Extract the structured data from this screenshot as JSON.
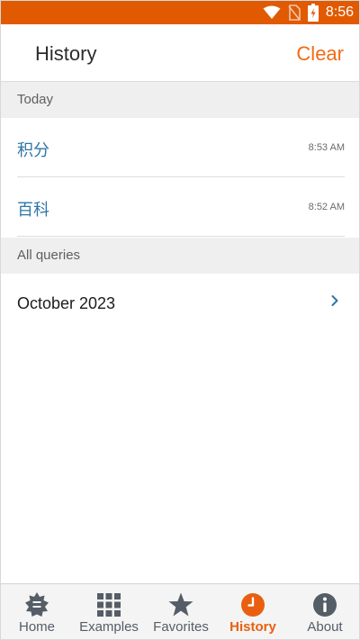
{
  "status_bar": {
    "time": "8:56",
    "background": "#e15a02",
    "icons": [
      "wifi-icon",
      "no-sim-icon",
      "battery-charging-icon"
    ]
  },
  "header": {
    "title": "History",
    "clear_label": "Clear",
    "accent_color": "#f26b15"
  },
  "today": {
    "heading": "Today",
    "items": [
      {
        "query": "积分",
        "time": "8:53 AM"
      },
      {
        "query": "百科",
        "time": "8:52 AM"
      }
    ]
  },
  "all_queries": {
    "heading": "All queries",
    "months": [
      {
        "label": "October 2023"
      }
    ]
  },
  "bottom_nav": {
    "items": [
      {
        "label": "Home",
        "icon": "home-gear-icon",
        "active": false
      },
      {
        "label": "Examples",
        "icon": "grid-icon",
        "active": false
      },
      {
        "label": "Favorites",
        "icon": "star-icon",
        "active": false
      },
      {
        "label": "History",
        "icon": "clock-icon",
        "active": true
      },
      {
        "label": "About",
        "icon": "info-icon",
        "active": false
      }
    ],
    "active_color": "#e95f0f",
    "inactive_color": "#555d66"
  }
}
